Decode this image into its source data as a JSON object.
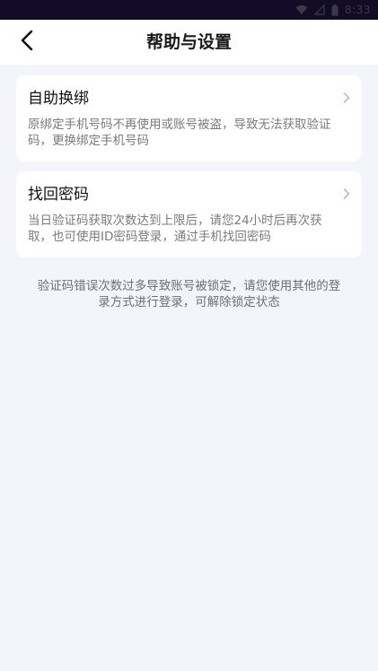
{
  "status_bar": {
    "time": "8:33",
    "icons": [
      "wifi-icon",
      "signal-icon",
      "battery-icon"
    ]
  },
  "header": {
    "title": "帮助与设置",
    "back_icon": "chevron-left-icon"
  },
  "cards": [
    {
      "title": "自助换绑",
      "description": "原绑定手机号码不再使用或账号被盗，导致无法获取验证码，更换绑定手机号码",
      "icon": "chevron-right-icon"
    },
    {
      "title": "找回密码",
      "description": "当日验证码获取次数达到上限后，请您24小时后再次获取，也可使用ID密码登录，通过手机找回密码",
      "icon": "chevron-right-icon"
    }
  ],
  "notice": "验证码错误次数过多导致账号被锁定，请您使用其他的登录方式进行登录，可解除锁定状态",
  "colors": {
    "status_bar_bg": "#120c27",
    "page_bg": "#f4f5fa",
    "card_bg": "#ffffff"
  }
}
